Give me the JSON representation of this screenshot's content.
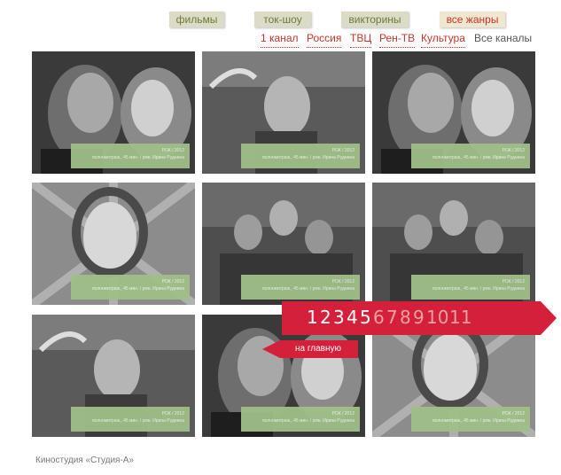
{
  "genre_tabs": [
    "фильмы",
    "ток-шоу",
    "викторины",
    "все жанры"
  ],
  "channels": [
    "1 канал",
    "Россия",
    "ТВЦ",
    "Рен-ТВ",
    "Культура",
    "Все каналы"
  ],
  "thumbnails": [
    {
      "scene": "couple",
      "line1": "РОК / 2012",
      "line2": "полнометраж., 45 мин. / реж. Ирина Руднина"
    },
    {
      "scene": "man-car",
      "line1": "РОК / 2012",
      "line2": "полнометраж., 45 мин. / реж. Ирина Руднина"
    },
    {
      "scene": "couple",
      "line1": "РОК / 2012",
      "line2": "полнометраж., 45 мин. / реж. Ирина Руднина"
    },
    {
      "scene": "woman",
      "line1": "РОК / 2012",
      "line2": "полнометраж., 45 мин. / реж. Ирина Руднина"
    },
    {
      "scene": "soldiers",
      "line1": "РОК / 2012",
      "line2": "полнометраж., 45 мин. / реж. Ирина Руднина"
    },
    {
      "scene": "soldiers",
      "line1": "РОК / 2012",
      "line2": "полнометраж., 45 мин. / реж. Ирина Руднина"
    },
    {
      "scene": "man-car",
      "line1": "РОК / 2012",
      "line2": "полнометраж., 45 мин. / реж. Ирина Руднина"
    },
    {
      "scene": "couple",
      "line1": "РОК / 2012",
      "line2": "полнометраж., 45 мин. / реж. Ирина Руднина"
    },
    {
      "scene": "woman",
      "line1": "РОК / 2012",
      "line2": "полнометраж., 45 мин. / реж. Ирина Руднина"
    }
  ],
  "pagination": {
    "pages": [
      "1",
      "2",
      "3",
      "4",
      "5",
      "6",
      "7",
      "8",
      "9",
      "10",
      "11"
    ],
    "highlighted_pages": 5
  },
  "home_button": "на главную",
  "footer": "Киностудия «Студия-А»",
  "colors": {
    "accent_red": "#d4203a",
    "caption_green": "#9fbf88",
    "tab_bg": "#dcdcc6"
  }
}
